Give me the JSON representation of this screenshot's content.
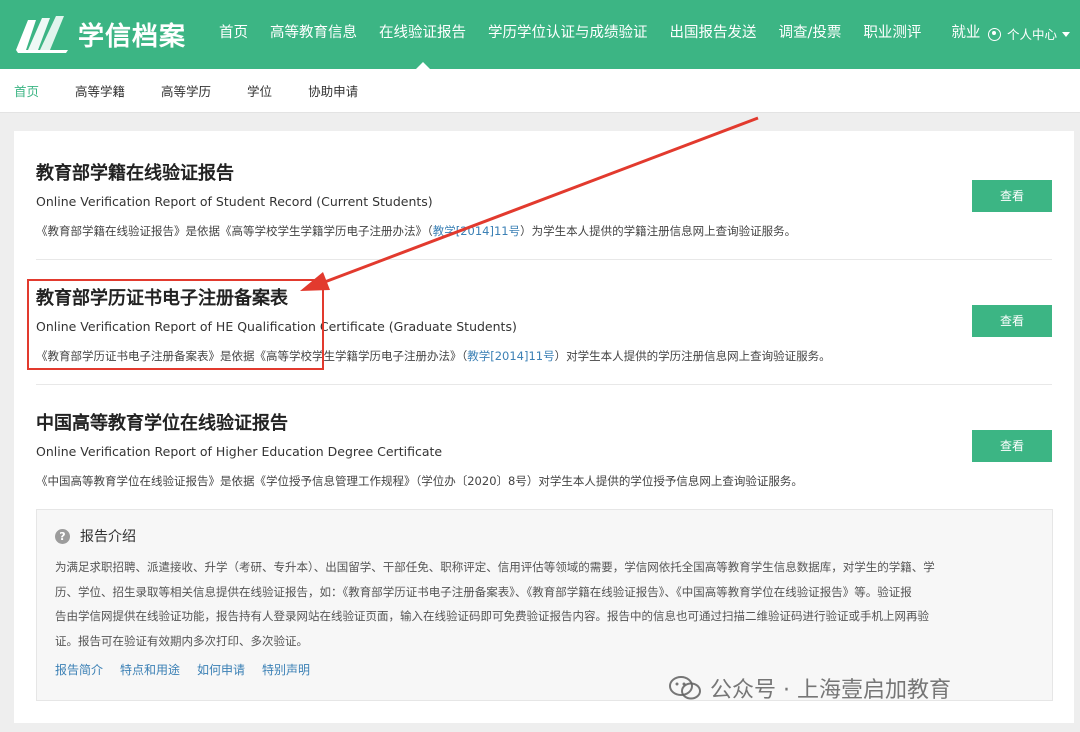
{
  "header": {
    "logo_text": "学信档案",
    "nav": [
      "首页",
      "高等教育信息",
      "在线验证报告",
      "学历学位认证与成绩验证",
      "出国报告发送",
      "调查/投票",
      "职业测评",
      "就业"
    ],
    "active_nav": "在线验证报告",
    "user_menu": "个人中心"
  },
  "subnav": {
    "items": [
      "首页",
      "高等学籍",
      "高等学历",
      "学位",
      "协助申请"
    ],
    "active": "首页"
  },
  "reports": [
    {
      "title": "教育部学籍在线验证报告",
      "subtitle": "Online Verification Report of Student Record (Current Students)",
      "desc_pre": "《教育部学籍在线验证报告》是依据《高等学校学生学籍学历电子注册办法》（",
      "desc_link": "教学[2014]11号",
      "desc_post": "）为学生本人提供的学籍注册信息网上查询验证服务。",
      "button": "查看"
    },
    {
      "title": "教育部学历证书电子注册备案表",
      "subtitle": "Online Verification Report of HE Qualification Certificate (Graduate Students)",
      "desc_pre": "《教育部学历证书电子注册备案表》是依据《高等学校学生学籍学历电子注册办法》（",
      "desc_link": "教学[2014]11号",
      "desc_post": "）对学生本人提供的学历注册信息网上查询验证服务。",
      "button": "查看"
    },
    {
      "title": "中国高等教育学位在线验证报告",
      "subtitle": "Online Verification Report of Higher Education Degree Certificate",
      "desc_pre": "《中国高等教育学位在线验证报告》是依据《学位授予信息管理工作规程》（学位办〔2020〕8号）对学生本人提供的学位授予信息网上查询验证服务。",
      "desc_link": "",
      "desc_post": "",
      "button": "查看"
    }
  ],
  "intro": {
    "title": "报告介绍",
    "lines": [
      "为满足求职招聘、派遣接收、升学（考研、专升本）、出国留学、干部任免、职称评定、信用评估等领域的需要，学信网依托全国高等教育学生信息数据库，对学生的学籍、学",
      "历、学位、招生录取等相关信息提供在线验证报告，如：《教育部学历证书电子注册备案表》、《教育部学籍在线验证报告》、《中国高等教育学位在线验证报告》等。验证报",
      "告由学信网提供在线验证功能，报告持有人登录网站在线验证页面，输入在线验证码即可免费验证报告内容。报告中的信息也可通过扫描二维验证码进行验证或手机上网再验",
      "证。报告可在验证有效期内多次打印、多次验证。"
    ],
    "links": [
      "报告简介",
      "特点和用途",
      "如何申请",
      "特别声明"
    ]
  },
  "watermark": "公众号 · 上海壹启加教育",
  "colors": {
    "brand": "#3cb584",
    "link": "#3b80b5",
    "annotation": "#e23a2e"
  }
}
